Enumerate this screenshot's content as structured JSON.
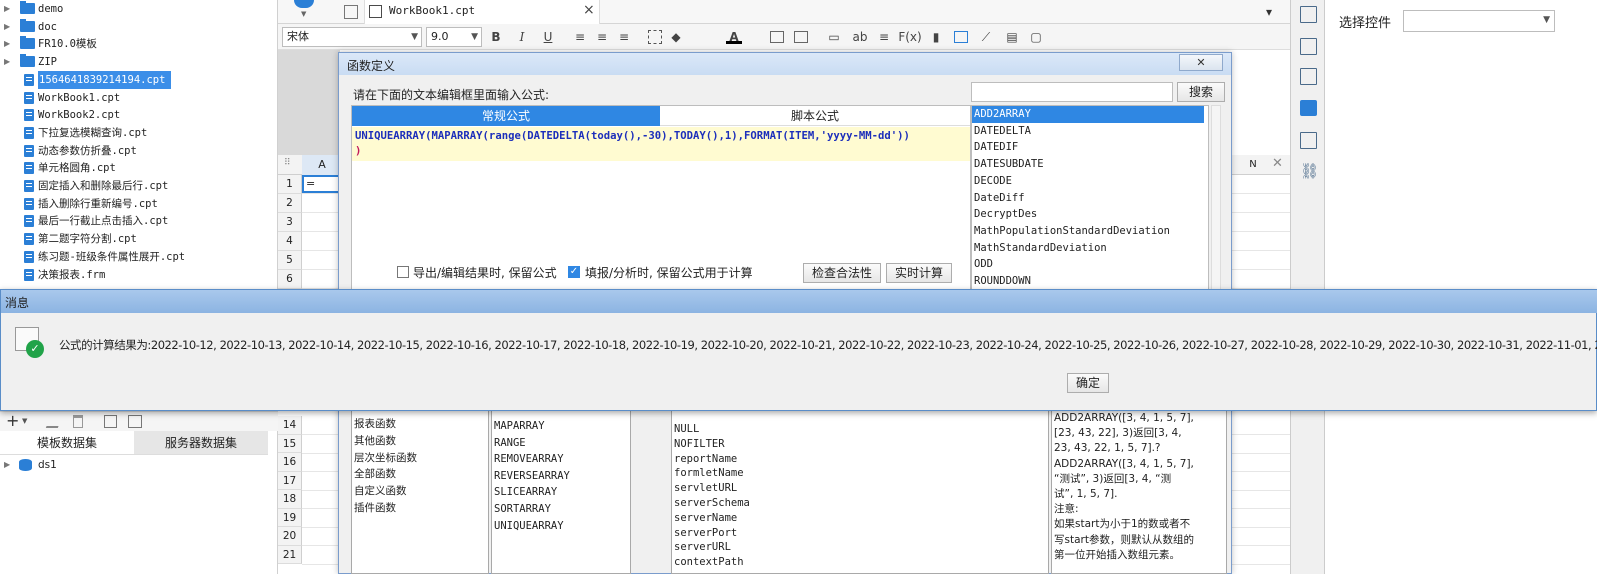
{
  "tree": {
    "items": [
      {
        "label": "demo",
        "type": "folder",
        "arrow": "▶"
      },
      {
        "label": "doc",
        "type": "folder",
        "arrow": "▶"
      },
      {
        "label": "FR10.0模板",
        "type": "folder",
        "arrow": "▶"
      },
      {
        "label": "ZIP",
        "type": "folder",
        "arrow": "▶"
      },
      {
        "label": "1564641839214194.cpt",
        "type": "file",
        "selected": true
      },
      {
        "label": "WorkBook1.cpt",
        "type": "file"
      },
      {
        "label": "WorkBook2.cpt",
        "type": "file"
      },
      {
        "label": "下拉复选模糊查询.cpt",
        "type": "file"
      },
      {
        "label": "动态参数仿折叠.cpt",
        "type": "file"
      },
      {
        "label": "单元格圆角.cpt",
        "type": "file"
      },
      {
        "label": "固定插入和删除最后行.cpt",
        "type": "file"
      },
      {
        "label": "插入删除行重新编号.cpt",
        "type": "file"
      },
      {
        "label": "最后一行截止点击插入.cpt",
        "type": "file"
      },
      {
        "label": "第二题字符分割.cpt",
        "type": "file"
      },
      {
        "label": "练习题-班级条件属性展开.cpt",
        "type": "file"
      },
      {
        "label": "决策报表.frm",
        "type": "file"
      }
    ]
  },
  "dataset_panel": {
    "add_symbol": "+",
    "tab_template": "模板数据集",
    "tab_server": "服务器数据集",
    "ds_item": "ds1",
    "arrow": "▶"
  },
  "editor_tab": {
    "label": "WorkBook1.cpt",
    "close": "×"
  },
  "toolbar": {
    "font_name": "宋体",
    "font_size": "9.0",
    "bold": "B",
    "italic": "I",
    "underline": "U",
    "fx": "F(x)",
    "ab": "ab",
    "color_a": "A"
  },
  "sheet": {
    "col_a": "A",
    "col_n": "N",
    "cell_value": "=",
    "rows_top": [
      "1",
      "2",
      "3",
      "4",
      "5",
      "6"
    ],
    "rows_bottom": [
      "14",
      "15",
      "16",
      "17",
      "18",
      "19",
      "20",
      "21"
    ]
  },
  "right_panel": {
    "select_widget_label": "选择控件",
    "select_widget_value": ""
  },
  "formula_dialog": {
    "title": "函数定义",
    "close": "✕",
    "instruction": "请在下面的文本编辑框里面输入公式:",
    "tab_normal": "常规公式",
    "tab_script": "脚本公式",
    "formula_line1": "UNIQUEARRAY(MAPARRAY(range(DATEDELTA(today(),-30),TODAY(),1),FORMAT(ITEM,'yyyy-MM-dd'))",
    "formula_line2": ")",
    "search_placeholder": "",
    "search_button": "搜索",
    "function_list": [
      "ADD2ARRAY",
      "DATEDELTA",
      "DATEDIF",
      "DATESUBDATE",
      "DECODE",
      "DateDiff",
      "DecryptDes",
      "MathPopulationStandardDeviation",
      "MathStandardDeviation",
      "ODD",
      "ROUNDDOWN"
    ],
    "checkbox_export": {
      "label": "导出/编辑结果时, 保留公式",
      "checked": false
    },
    "checkbox_fill": {
      "label": "填报/分析时, 保留公式用于计算",
      "checked": true
    },
    "btn_check": "检查合法性",
    "btn_realtime": "实时计算",
    "categories": [
      "报表函数",
      "其他函数",
      "层次坐标函数",
      "全部函数",
      "自定义函数",
      "插件函数"
    ],
    "array_functions": [
      "MAPARRAY",
      "RANGE",
      "REMOVEARRAY",
      "REVERSEARRAY",
      "SLICEARRAY",
      "SORTARRAY",
      "UNIQUEARRAY"
    ],
    "variables": [
      "NULL",
      "NOFILTER",
      "reportName",
      "formletName",
      "servletURL",
      "serverSchema",
      "serverName",
      "serverPort",
      "serverURL",
      "contextPath"
    ],
    "desc_lines": [
      "ADD2ARRAY([3, 4, 1, 5, 7],",
      "[23, 43, 22], 3)返回[3, 4,",
      "23, 43, 22, 1, 5, 7].?",
      "ADD2ARRAY([3, 4, 1, 5, 7],",
      "“测试”, 3)返回[3, 4, “测",
      "试”, 1, 5, 7].",
      "注意:",
      "如果start为小于1的数或者不",
      "写start参数，则默认从数组的",
      "第一位开始插入数组元素。"
    ]
  },
  "message_dialog": {
    "title": "消息",
    "text": "公式的计算结果为:2022-10-12, 2022-10-13, 2022-10-14, 2022-10-15, 2022-10-16, 2022-10-17, 2022-10-18, 2022-10-19, 2022-10-20, 2022-10-21, 2022-10-22, 2022-10-23, 2022-10-24, 2022-10-25, 2022-10-26, 2022-10-27, 2022-10-28, 2022-10-29, 2022-10-30, 2022-10-31, 2022-11-01, 2022-11-0",
    "ok_button": "确定"
  }
}
